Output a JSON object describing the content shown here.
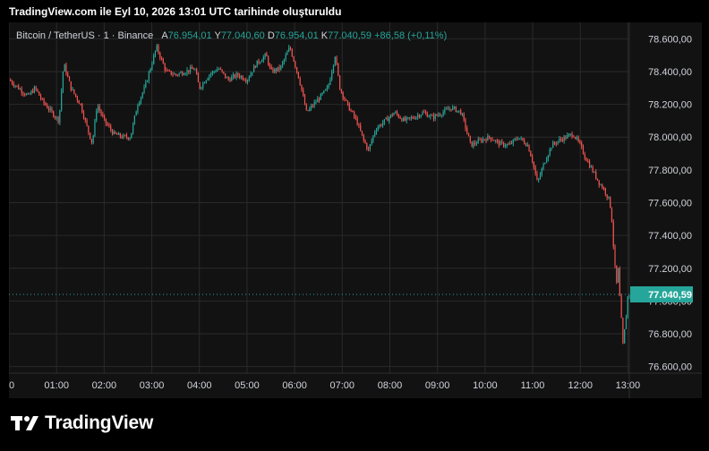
{
  "header": {
    "caption": "TradingView.com ile Eyl 10, 2026 13:01 UTC tarihinde oluşturuldu"
  },
  "legend": {
    "symbol": "Bitcoin / TetherUS · 1 · Binance",
    "open_label": "A",
    "open_value": "76.954,01",
    "high_label": "Y",
    "high_value": "77.040,60",
    "low_label": "D",
    "low_value": "76.954,01",
    "close_label": "K",
    "close_value": "77.040,59",
    "change": "+86,58 (+0,11%)"
  },
  "footer": {
    "brand": "TradingView"
  },
  "colors": {
    "up": "#26a69a",
    "down": "#ef5350",
    "background": "#121212",
    "grid": "#2a2a2a",
    "text": "#d1d4dc",
    "price_label_bg": "#26a69a"
  },
  "chart_data": {
    "type": "candlestick",
    "title": "Bitcoin / TetherUS · 1 · Binance",
    "interval": "1 minute",
    "ylim": [
      76560,
      78700
    ],
    "y_ticks": [
      {
        "value": 78600,
        "label": "78.600,00"
      },
      {
        "value": 78400,
        "label": "78.400,00"
      },
      {
        "value": 78200,
        "label": "78.200,00"
      },
      {
        "value": 78000,
        "label": "78.000,00"
      },
      {
        "value": 77800,
        "label": "77.800,00"
      },
      {
        "value": 77600,
        "label": "77.600,00"
      },
      {
        "value": 77400,
        "label": "77.400,00"
      },
      {
        "value": 77200,
        "label": "77.200,00"
      },
      {
        "value": 77000,
        "label": "77.000,00"
      },
      {
        "value": 76800,
        "label": "76.800,00"
      },
      {
        "value": 76600,
        "label": "76.600,00"
      }
    ],
    "x_ticks": [
      {
        "hour": 0,
        "label": "0"
      },
      {
        "hour": 1,
        "label": "01:00"
      },
      {
        "hour": 2,
        "label": "02:00"
      },
      {
        "hour": 3,
        "label": "03:00"
      },
      {
        "hour": 4,
        "label": "04:00"
      },
      {
        "hour": 5,
        "label": "05:00"
      },
      {
        "hour": 6,
        "label": "06:00"
      },
      {
        "hour": 7,
        "label": "07:00"
      },
      {
        "hour": 8,
        "label": "08:00"
      },
      {
        "hour": 9,
        "label": "09:00"
      },
      {
        "hour": 10,
        "label": "10:00"
      },
      {
        "hour": 11,
        "label": "11:00"
      },
      {
        "hour": 12,
        "label": "12:00"
      },
      {
        "hour": 13,
        "label": "13:00"
      }
    ],
    "x_range_hours": [
      0,
      13.03
    ],
    "current_price": {
      "value": 77040.59,
      "label": "77.040,59"
    },
    "close_path": [
      [
        0.0,
        78350
      ],
      [
        0.2,
        78300
      ],
      [
        0.4,
        78250
      ],
      [
        0.55,
        78300
      ],
      [
        0.7,
        78220
      ],
      [
        0.9,
        78150
      ],
      [
        1.05,
        78100
      ],
      [
        1.15,
        78450
      ],
      [
        1.3,
        78300
      ],
      [
        1.5,
        78200
      ],
      [
        1.65,
        78050
      ],
      [
        1.75,
        77960
      ],
      [
        1.85,
        78200
      ],
      [
        2.0,
        78100
      ],
      [
        2.2,
        78020
      ],
      [
        2.4,
        78000
      ],
      [
        2.55,
        78000
      ],
      [
        2.7,
        78200
      ],
      [
        2.85,
        78300
      ],
      [
        3.0,
        78450
      ],
      [
        3.1,
        78550
      ],
      [
        3.3,
        78400
      ],
      [
        3.5,
        78380
      ],
      [
        3.7,
        78400
      ],
      [
        3.9,
        78420
      ],
      [
        4.0,
        78300
      ],
      [
        4.2,
        78380
      ],
      [
        4.4,
        78420
      ],
      [
        4.6,
        78350
      ],
      [
        4.8,
        78380
      ],
      [
        5.0,
        78350
      ],
      [
        5.2,
        78450
      ],
      [
        5.4,
        78500
      ],
      [
        5.5,
        78400
      ],
      [
        5.7,
        78420
      ],
      [
        5.9,
        78550
      ],
      [
        6.0,
        78450
      ],
      [
        6.1,
        78350
      ],
      [
        6.25,
        78150
      ],
      [
        6.4,
        78200
      ],
      [
        6.55,
        78250
      ],
      [
        6.7,
        78300
      ],
      [
        6.85,
        78500
      ],
      [
        6.95,
        78300
      ],
      [
        7.1,
        78200
      ],
      [
        7.3,
        78100
      ],
      [
        7.45,
        77980
      ],
      [
        7.55,
        77920
      ],
      [
        7.7,
        78050
      ],
      [
        7.9,
        78100
      ],
      [
        8.1,
        78150
      ],
      [
        8.3,
        78100
      ],
      [
        8.5,
        78120
      ],
      [
        8.7,
        78150
      ],
      [
        8.9,
        78120
      ],
      [
        9.1,
        78150
      ],
      [
        9.3,
        78180
      ],
      [
        9.5,
        78150
      ],
      [
        9.6,
        78050
      ],
      [
        9.7,
        77950
      ],
      [
        9.9,
        77980
      ],
      [
        10.1,
        78000
      ],
      [
        10.3,
        77960
      ],
      [
        10.5,
        77950
      ],
      [
        10.7,
        78000
      ],
      [
        10.9,
        77950
      ],
      [
        11.0,
        77850
      ],
      [
        11.1,
        77720
      ],
      [
        11.25,
        77850
      ],
      [
        11.4,
        77950
      ],
      [
        11.55,
        77980
      ],
      [
        11.7,
        78000
      ],
      [
        11.85,
        78020
      ],
      [
        12.0,
        77950
      ],
      [
        12.1,
        77880
      ],
      [
        12.25,
        77800
      ],
      [
        12.4,
        77720
      ],
      [
        12.5,
        77680
      ],
      [
        12.6,
        77620
      ],
      [
        12.65,
        77550
      ],
      [
        12.7,
        77320
      ],
      [
        12.73,
        77200
      ],
      [
        12.76,
        77100
      ],
      [
        12.8,
        77200
      ],
      [
        12.83,
        77020
      ],
      [
        12.86,
        76900
      ],
      [
        12.88,
        76780
      ],
      [
        12.9,
        76720
      ],
      [
        12.93,
        76820
      ],
      [
        12.96,
        76900
      ],
      [
        12.98,
        76954.01
      ],
      [
        13.0,
        77040.59
      ]
    ]
  }
}
